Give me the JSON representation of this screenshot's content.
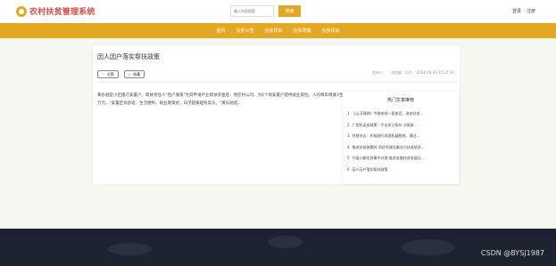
{
  "header": {
    "logo_text": "农村扶贫管理系统",
    "search_placeholder": "输入内容搜索",
    "search_button": "搜索",
    "login": "登录",
    "register": "注册"
  },
  "nav": [
    "首页",
    "扶贫公告",
    "扶贫项目",
    "扶贫政策",
    "扶贫项目"
  ],
  "article": {
    "title": "因人因户落实帮扶政策",
    "like_label": "点赞",
    "favorite_label": "收藏",
    "meta": {
      "author": "发布人：",
      "views": "浏览量：121",
      "time": "2024-03-29 15:27:37"
    },
    "content": "黄乐驰是小区搬迁安置户。帮扶责任人\"因户施策\"为其申请产业帮扶资金后，他在村公司、为5个易安置户提供就业岗位，人均每年增收3至5万元。\"安置区有舒适、生活便利、就业政策好，日子越来越有奔头。\"黄乐驰说。"
  },
  "hot": {
    "title": "热门文章推荐",
    "items": [
      "《山河锦绣》今晚央视一套收官，讲述扶贫…",
      "广西防返贫政策：平台关注帮扶 对照来…",
      "扶贫扶志：积极践行巩固拓展脱贫，通过…",
      "推进扶贫政策时 同优秀建设事业与扶贫结合…",
      "开展小额信贷事中办理 推进金融扶贫发展见…",
      "因人因户落实帮扶政策"
    ]
  },
  "watermark": "CSDN @BYSJ1987"
}
